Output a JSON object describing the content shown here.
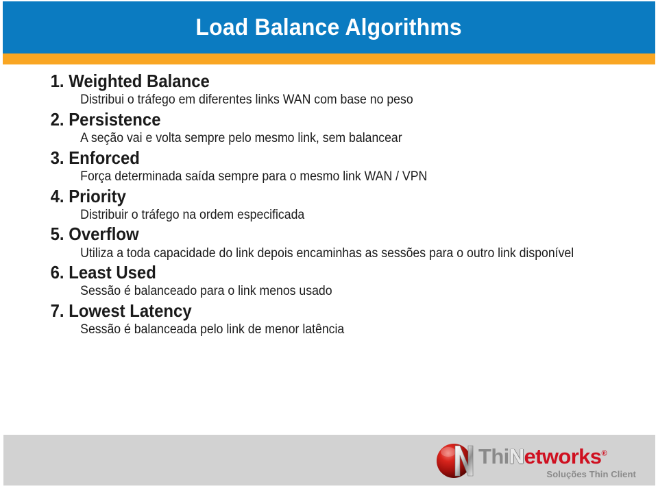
{
  "header": {
    "title": "Load Balance Algorithms",
    "band_color": "#0b7bc1",
    "accent_color": "#f9a623"
  },
  "content": {
    "items": [
      {
        "number": "1.",
        "title": "Weighted Balance",
        "description": "Distribui o tráfego em diferentes links WAN com base no peso"
      },
      {
        "number": "2.",
        "title": "Persistence",
        "description": "A seção vai e volta sempre pelo mesmo link, sem balancear"
      },
      {
        "number": "3.",
        "title": "Enforced",
        "description": "Força determinada saída sempre para o mesmo link WAN / VPN"
      },
      {
        "number": "4.",
        "title": "Priority",
        "description": "Distribuir o tráfego na ordem especificada"
      },
      {
        "number": "5.",
        "title": "Overflow",
        "description": "Utiliza a toda capacidade do link depois encaminhas as sessões para o outro link disponível"
      },
      {
        "number": "6.",
        "title": "Least Used",
        "description": "Sessão é balanceado para o link menos usado"
      },
      {
        "number": "7.",
        "title": "Lowest Latency",
        "description": "Sessão é balanceada pelo link de menor latência"
      }
    ]
  },
  "footer": {
    "band_color": "#d2d2d2",
    "logo": {
      "icon": "red-sphere-n-icon",
      "word_thi": "Thi",
      "word_n": "N",
      "word_networks": "etworks",
      "registered_mark": "®",
      "tagline": "Soluções Thin Client",
      "thi_color": "#8a8a8a",
      "networks_color": "#cf1020",
      "sphere_color": "#c01818"
    }
  }
}
